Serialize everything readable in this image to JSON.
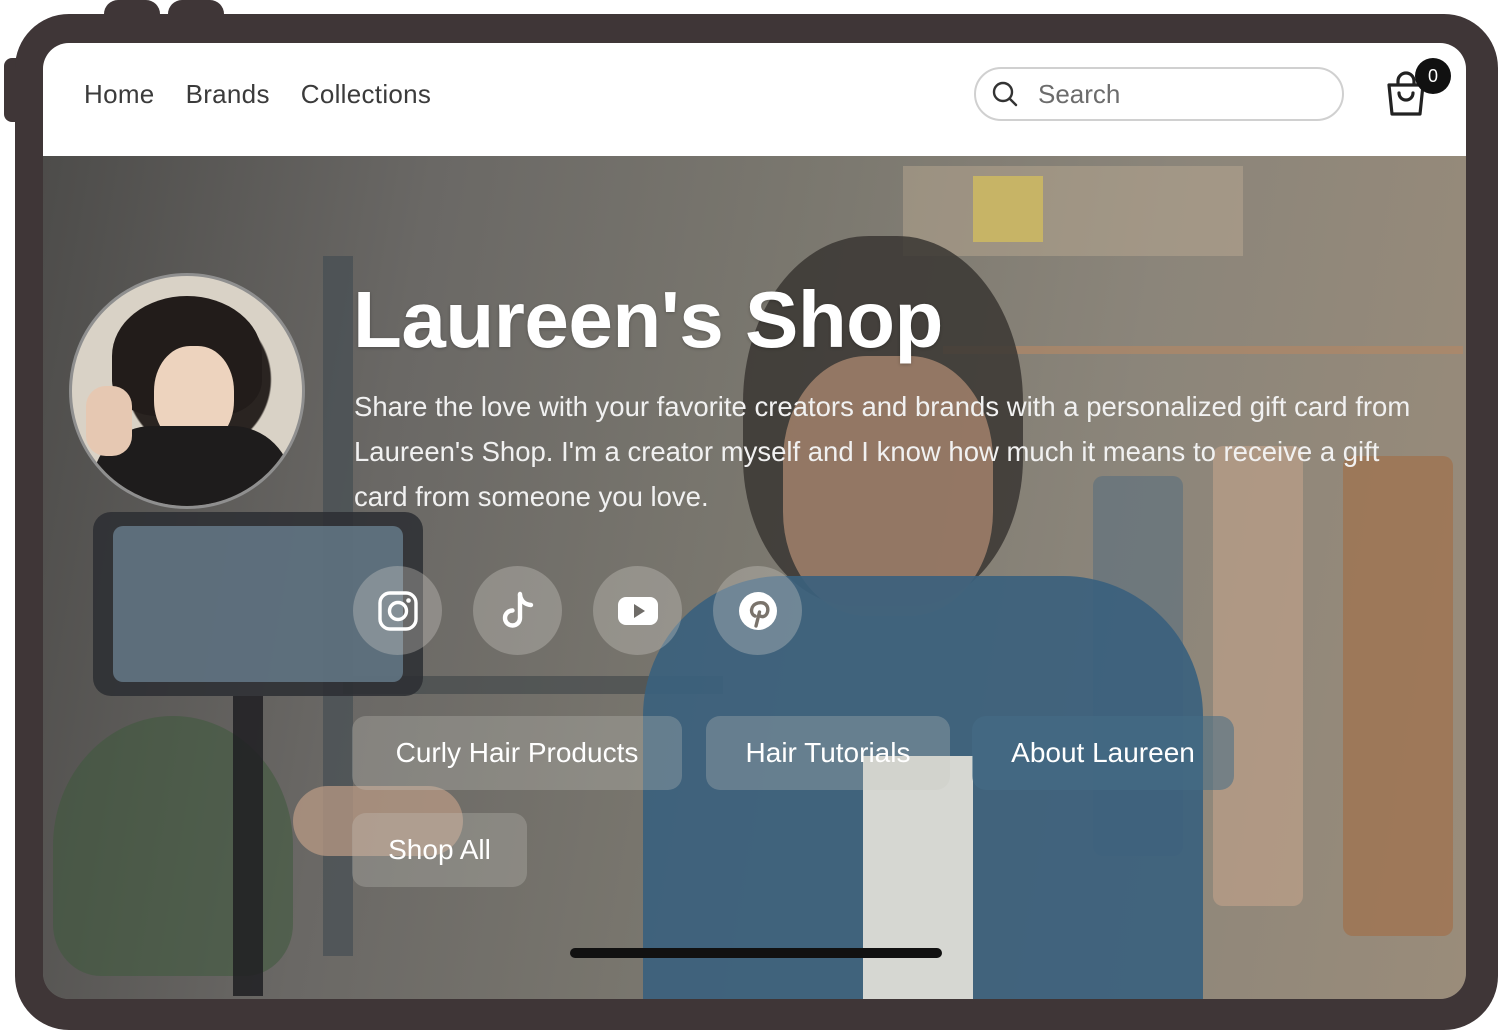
{
  "nav": {
    "links": [
      "Home",
      "Brands",
      "Collections"
    ],
    "search_placeholder": "Search",
    "cart_count": "0"
  },
  "hero": {
    "title": "Laureen's Shop",
    "description": "Share the love with your favorite creators and brands with a personalized gift card from Laureen's Shop. I'm a creator myself and I know how much it means to receive a gift card from someone you love.",
    "socials": [
      "instagram-icon",
      "tiktok-icon",
      "youtube-icon",
      "pinterest-icon"
    ],
    "buttons": [
      "Curly Hair Products",
      "Hair Tutorials",
      "About Laureen",
      "Shop All"
    ]
  },
  "colors": {
    "frame": "#3f3637",
    "nav_bg": "#ffffff",
    "text_dark": "#3b3b3b",
    "hero_text": "#ffffff"
  }
}
